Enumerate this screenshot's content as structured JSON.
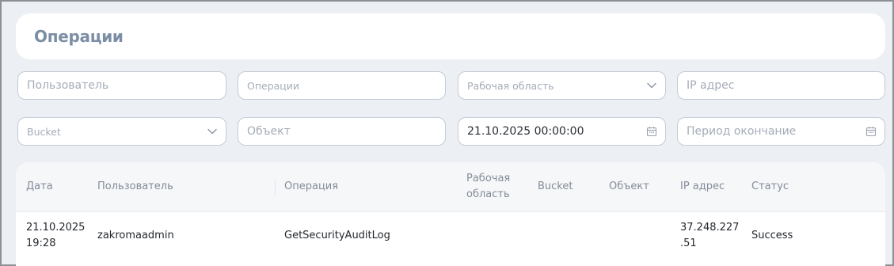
{
  "page": {
    "title": "Операции"
  },
  "filters": {
    "user_placeholder": "Пользователь",
    "operation_placeholder": "Операции",
    "workspace_placeholder": "Рабочая область",
    "ip_placeholder": "IP адрес",
    "bucket_placeholder": "Bucket",
    "object_placeholder": "Объект",
    "period_start_value": "21.10.2025 00:00:00",
    "period_end_placeholder": "Период окончание"
  },
  "icons": {
    "workspace_dropdown": "chevron-down-icon",
    "bucket_dropdown": "chevron-down-icon",
    "period_start": "calendar-icon",
    "period_end": "calendar-icon"
  },
  "table": {
    "columns": [
      "Дата",
      "Пользователь",
      "Операция",
      "Рабочая область",
      "Bucket",
      "Объект",
      "IP адрес",
      "Статус"
    ],
    "rows": [
      {
        "date": "21.10.2025",
        "time": "19:28",
        "user": "zakromaadmin",
        "operation": "GetSecurityAuditLog",
        "workspace": "",
        "bucket": "",
        "object": "",
        "ip_line1": "37.248.227",
        "ip_line2": ".51",
        "status": "Success"
      }
    ]
  },
  "colors": {
    "background": "#eceff3",
    "title": "#7c8ea6",
    "field_border": "#c5ccd6"
  }
}
